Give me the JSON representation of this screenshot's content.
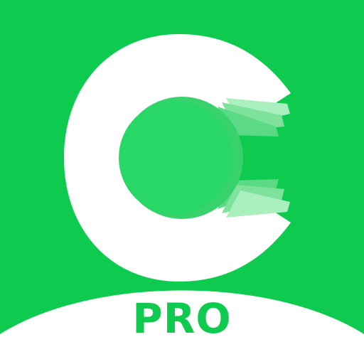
{
  "icon": {
    "name": "c-coin-logo-icon",
    "colors": {
      "background": "#0ECB4F",
      "letter": "#FFFFFF",
      "coin": "#29D767",
      "coin_edge": "#38D26C",
      "flap_light": "#A9F0BE",
      "flap_mid": "#7FE29C",
      "label": "#0ECB4F"
    }
  },
  "badge": {
    "label": "PRO"
  }
}
